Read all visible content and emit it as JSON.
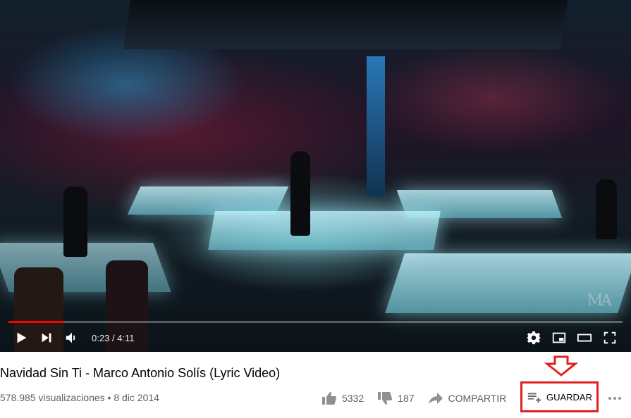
{
  "video": {
    "watermark": "MA",
    "time_current": "0:23",
    "time_separator": "/",
    "time_total": "4:11",
    "progress": 0.09
  },
  "meta": {
    "title": "Navidad Sin Ti - Marco Antonio Solís (Lyric Video)",
    "views": "578.985 visualizaciones",
    "bullet": "•",
    "date": "8 dic 2014"
  },
  "actions": {
    "likes": "5332",
    "dislikes": "187",
    "share": "COMPARTIR",
    "save": "GUARDAR"
  },
  "icons": {
    "play": "play-icon",
    "next": "next-icon",
    "volume": "volume-icon",
    "settings": "gear-icon",
    "miniplayer": "miniplayer-icon",
    "theater": "theater-icon",
    "fullscreen": "fullscreen-icon",
    "like": "thumbs-up-icon",
    "dislike": "thumbs-down-icon",
    "share": "share-arrow-icon",
    "save": "playlist-add-icon",
    "more": "more-horizontal-icon"
  },
  "colors": {
    "progress": "#ff0000",
    "annotation": "#e32020"
  }
}
